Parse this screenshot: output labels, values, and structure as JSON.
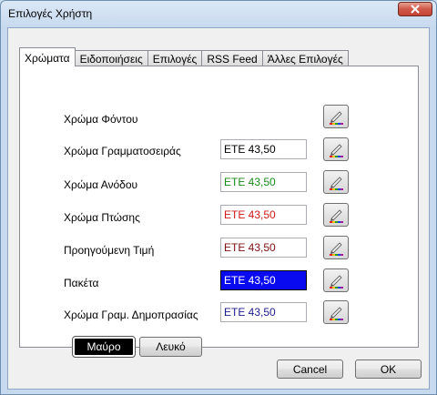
{
  "window": {
    "title": "Επιλογές Χρήστη"
  },
  "tabs": [
    {
      "label": "Χρώματα",
      "active": true
    },
    {
      "label": "Ειδοποιήσεις",
      "active": false
    },
    {
      "label": "Επιλογές",
      "active": false
    },
    {
      "label": "RSS Feed",
      "active": false
    },
    {
      "label": "Άλλες Επιλογές",
      "active": false
    }
  ],
  "colors": {
    "rows": [
      {
        "label": "Χρώμα Φόντου",
        "sample": "",
        "sample_color": "",
        "sample_bg": ""
      },
      {
        "label": "Χρώμα Γραμματοσειράς",
        "sample": "ΕΤΕ 43,50",
        "sample_color": "#000000",
        "sample_bg": "#ffffff"
      },
      {
        "label": "Χρώμα Ανόδου",
        "sample": "ΕΤΕ 43,50",
        "sample_color": "#1a8a1a",
        "sample_bg": "#ffffff"
      },
      {
        "label": "Χρώμα Πτώσης",
        "sample": "ΕΤΕ 43,50",
        "sample_color": "#d01818",
        "sample_bg": "#ffffff"
      },
      {
        "label": "Προηγούμενη Τιμή",
        "sample": "ΕΤΕ 43,50",
        "sample_color": "#7a1010",
        "sample_bg": "#ffffff"
      },
      {
        "label": "Πακέτα",
        "sample": "ΕΤΕ 43,50",
        "sample_color": "#ffffff",
        "sample_bg": "#0a0af0"
      },
      {
        "label": "Χρώμα Γραμ. Δημοπρασίας",
        "sample": "ΕΤΕ 43,50",
        "sample_color": "#1c1c8c",
        "sample_bg": "#ffffff"
      }
    ],
    "icon": "pencil-color-picker-icon",
    "black_button": "Μαύρο",
    "white_button": "Λευκό"
  },
  "footer": {
    "cancel_label": "Cancel",
    "ok_label": "OK"
  }
}
